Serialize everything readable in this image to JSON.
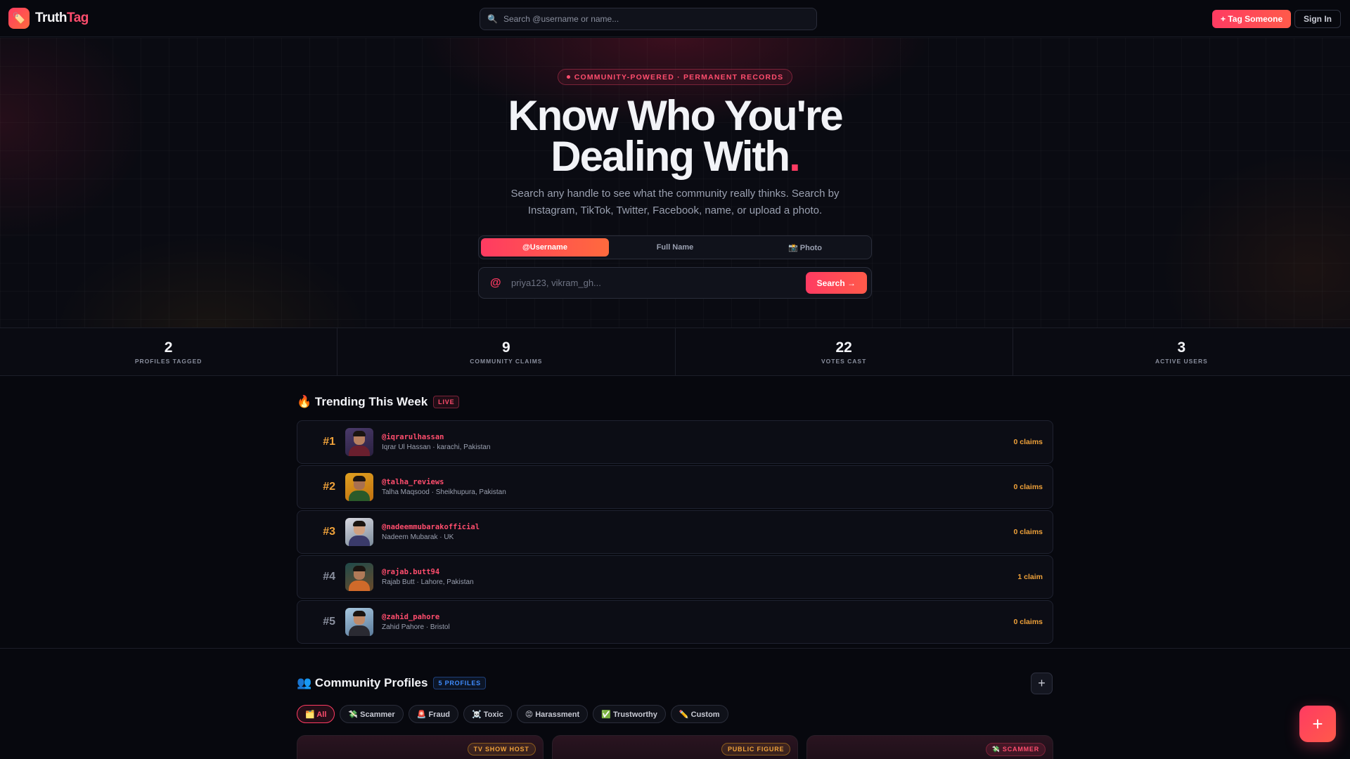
{
  "nav": {
    "logo_icon": "tag-icon",
    "logo_part1": "Truth",
    "logo_part2": "Tag",
    "search_placeholder": "Search @username or name...",
    "tag_button": "+ Tag Someone",
    "signin_button": "Sign In"
  },
  "hero": {
    "badge": "COMMUNITY-POWERED · PERMANENT RECORDS",
    "title_line1": "Know Who You're",
    "title_line2": "Dealing With",
    "title_dot": ".",
    "subtitle": "Search any handle to see what the community really thinks. Search by Instagram, TikTok, Twitter, Facebook, name, or upload a photo.",
    "tabs": [
      "@Username",
      "Full Name",
      "📸 Photo"
    ],
    "active_tab": "@Username",
    "search_prefix": "@",
    "search_placeholder": "priya123, vikram_gh...",
    "search_button": "Search →"
  },
  "stats": [
    {
      "value": "2",
      "label": "PROFILES TAGGED"
    },
    {
      "value": "9",
      "label": "COMMUNITY CLAIMS"
    },
    {
      "value": "22",
      "label": "VOTES CAST"
    },
    {
      "value": "3",
      "label": "ACTIVE USERS"
    }
  ],
  "trending": {
    "title": "🔥 Trending This Week",
    "badge": "LIVE",
    "items": [
      {
        "rank": "#1",
        "handle": "@iqrarulhassan",
        "meta": "Iqrar Ul Hassan · karachi, Pakistan",
        "claims": "0 claims"
      },
      {
        "rank": "#2",
        "handle": "@talha_reviews",
        "meta": "Talha Maqsood · Sheikhupura, Pakistan",
        "claims": "0 claims"
      },
      {
        "rank": "#3",
        "handle": "@nadeemmubarakofficial",
        "meta": "Nadeem Mubarak · UK",
        "claims": "0 claims"
      },
      {
        "rank": "#4",
        "handle": "@rajab.butt94",
        "meta": "Rajab Butt · Lahore, Pakistan",
        "claims": "1 claim"
      },
      {
        "rank": "#5",
        "handle": "@zahid_pahore",
        "meta": "Zahid Pahore · Bristol",
        "claims": "0 claims"
      }
    ]
  },
  "community": {
    "title": "👥 Community Profiles",
    "count_badge": "5 PROFILES",
    "add_icon": "+",
    "filters": [
      "🗂️ All",
      "💸 Scammer",
      "🚨 Fraud",
      "☠️ Toxic",
      "😡 Harassment",
      "✅ Trustworthy",
      "✏️ Custom"
    ],
    "active_filter": "🗂️ All",
    "cards": [
      {
        "badge": "TV SHOW HOST"
      },
      {
        "badge": "PUBLIC FIGURE"
      },
      {
        "badge": "💸 SCAMMER"
      }
    ]
  },
  "fab": "+"
}
